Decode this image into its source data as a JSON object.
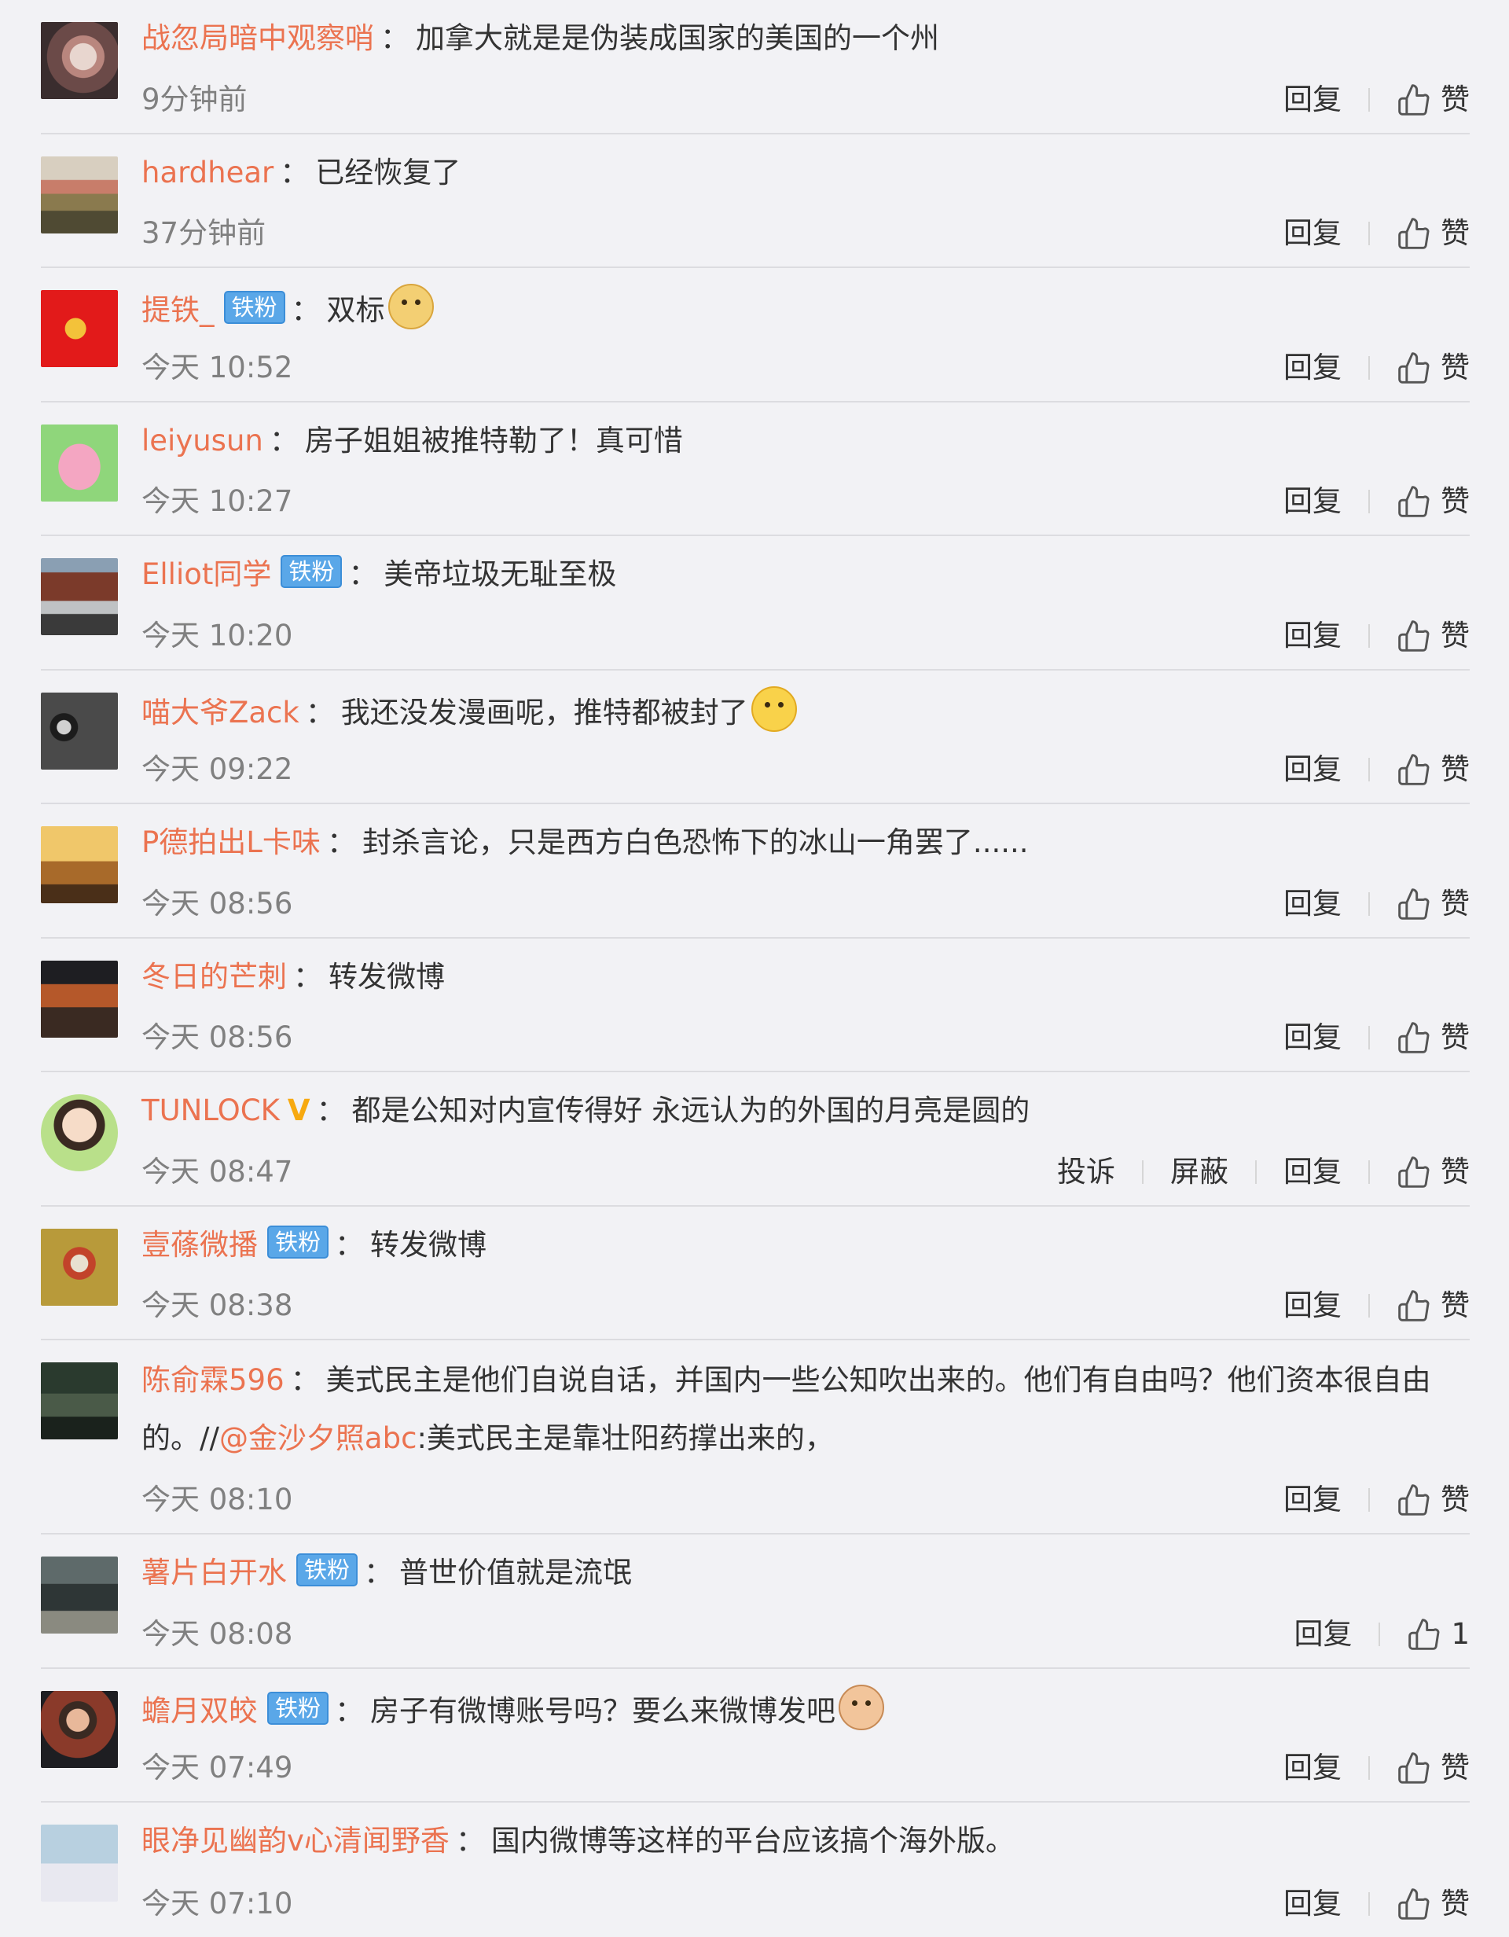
{
  "labels": {
    "reply": "回复",
    "like": "赞",
    "report": "投诉",
    "block": "屏蔽"
  },
  "comments": [
    {
      "user": "战忽局暗中观察哨",
      "text": "加拿大就是是伪装成国家的美国的一个州",
      "time": "9分钟前",
      "likes": "赞"
    },
    {
      "user": "hardhear",
      "text": "已经恢复了",
      "time": "37分钟前",
      "likes": "赞"
    },
    {
      "user": "提铁_",
      "badge": "铁粉",
      "text": "双标",
      "emoji": "doge",
      "time": "今天 10:52",
      "likes": "赞"
    },
    {
      "user": "leiyusun",
      "text": "房子姐姐被推特勒了！真可惜",
      "time": "今天 10:27",
      "likes": "赞"
    },
    {
      "user": "Elliot同学",
      "badge": "铁粉",
      "text": "美帝垃圾无耻至极",
      "time": "今天 10:20",
      "likes": "赞"
    },
    {
      "user": "喵大爷Zack",
      "text": "我还没发漫画呢，推特都被封了",
      "emoji": "shh",
      "time": "今天 09:22",
      "likes": "赞"
    },
    {
      "user": "P德拍出L卡味",
      "text": "封杀言论，只是西方白色恐怖下的冰山一角罢了......",
      "time": "今天 08:56",
      "likes": "赞"
    },
    {
      "user": "冬日的芒刺",
      "text": "转发微博",
      "time": "今天 08:56",
      "likes": "赞"
    },
    {
      "user": "TUNLOCK",
      "vip": "V",
      "text": "都是公知对内宣传得好 永远认为的外国的月亮是圆的",
      "time": "今天 08:47",
      "likes": "赞"
    },
    {
      "user": "壹蓧微播",
      "badge": "铁粉",
      "text": "转发微博",
      "time": "今天 08:38",
      "likes": "赞"
    },
    {
      "user": "陈俞霖596",
      "text": "美式民主是他们自说自话，并国内一些公知吹出来的。他们有自由吗？他们资本很自由的。//",
      "mention": "@金沙夕照abc",
      "text2": ":美式民主是靠壮阳药撑出来的，",
      "time": "今天 08:10",
      "likes": "赞"
    },
    {
      "user": "薯片白开水",
      "badge": "铁粉",
      "text": "普世价值就是流氓",
      "time": "今天 08:08",
      "likes": "1"
    },
    {
      "user": "蟾月双皎",
      "badge": "铁粉",
      "text": "房子有微博账号吗？要么来微博发吧",
      "emoji": "cat",
      "time": "今天 07:49",
      "likes": "赞"
    },
    {
      "user": "眼净见幽韵v心清闻野香",
      "text": "国内微博等这样的平台应该搞个海外版。",
      "time": "今天 07:10",
      "likes": "赞"
    }
  ],
  "colors": {
    "username": "#eb7350",
    "badge": "#5aa7e8",
    "vip": "#f7a910",
    "background": "#f2f2f5"
  }
}
